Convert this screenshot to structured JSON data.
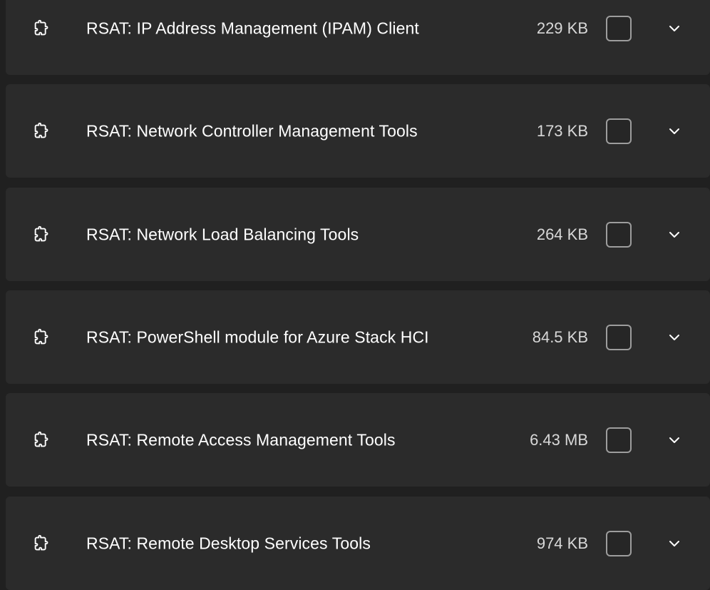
{
  "features": [
    {
      "name": "RSAT: IP Address Management (IPAM) Client",
      "size": "229 KB",
      "icon": "puzzle-icon",
      "checked": false
    },
    {
      "name": "RSAT: Network Controller Management Tools",
      "size": "173 KB",
      "icon": "puzzle-icon",
      "checked": false
    },
    {
      "name": "RSAT: Network Load Balancing Tools",
      "size": "264 KB",
      "icon": "puzzle-icon",
      "checked": false
    },
    {
      "name": "RSAT: PowerShell module for Azure Stack HCI",
      "size": "84.5 KB",
      "icon": "puzzle-icon",
      "checked": false
    },
    {
      "name": "RSAT: Remote Access Management Tools",
      "size": "6.43 MB",
      "icon": "puzzle-icon",
      "checked": false
    },
    {
      "name": "RSAT: Remote Desktop Services Tools",
      "size": "974 KB",
      "icon": "puzzle-icon",
      "checked": false
    }
  ],
  "colors": {
    "background": "#202020",
    "card": "#2b2b2b",
    "text": "#ffffff",
    "secondary_text": "#d8d8d8",
    "checkbox_border": "#9d9d9d"
  }
}
